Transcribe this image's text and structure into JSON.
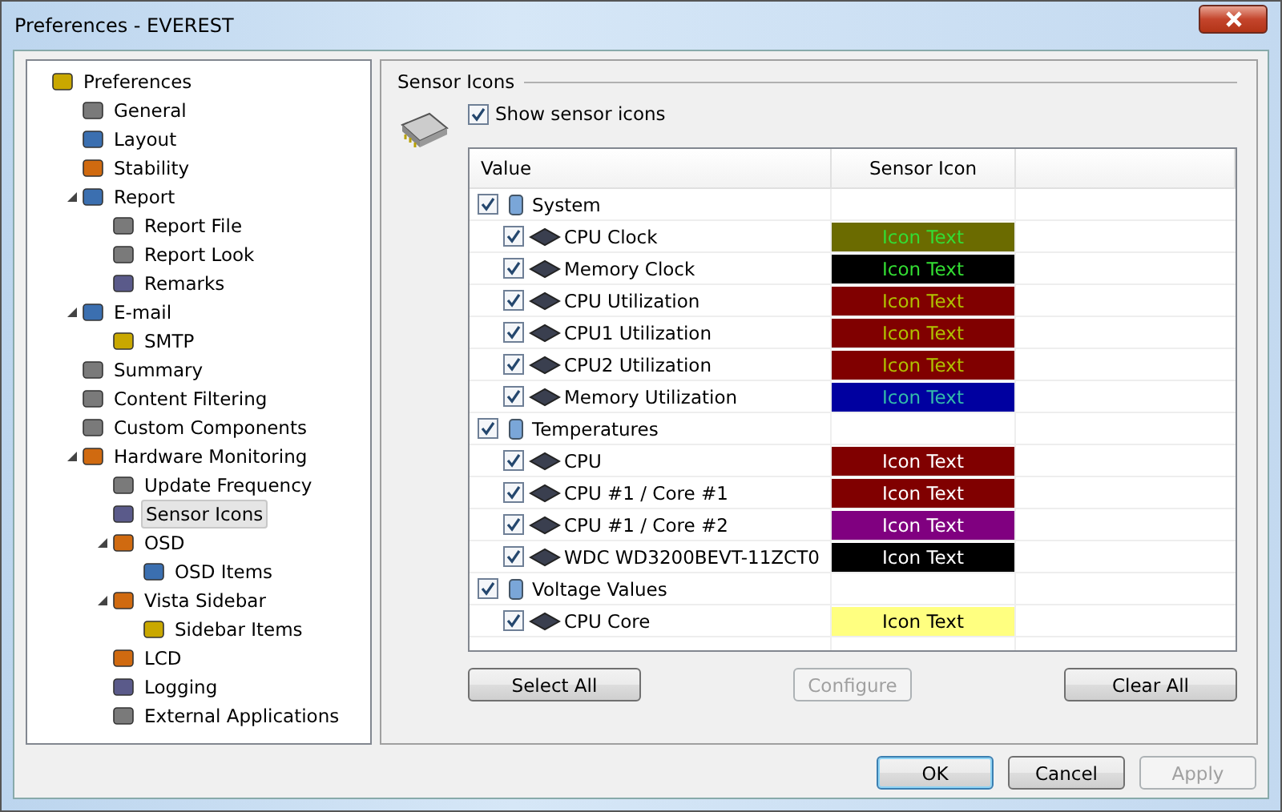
{
  "window": {
    "title": "Preferences - EVEREST"
  },
  "tree": [
    {
      "label": "Preferences",
      "selected": false,
      "children": [
        {
          "label": "General",
          "selected": false
        },
        {
          "label": "Layout",
          "selected": false
        },
        {
          "label": "Stability",
          "selected": false
        },
        {
          "label": "Report",
          "selected": false,
          "expanded": true,
          "children": [
            {
              "label": "Report File",
              "selected": false
            },
            {
              "label": "Report Look",
              "selected": false
            },
            {
              "label": "Remarks",
              "selected": false
            }
          ]
        },
        {
          "label": "E-mail",
          "selected": false,
          "expanded": true,
          "children": [
            {
              "label": "SMTP",
              "selected": false
            }
          ]
        },
        {
          "label": "Summary",
          "selected": false
        },
        {
          "label": "Content Filtering",
          "selected": false
        },
        {
          "label": "Custom Components",
          "selected": false
        },
        {
          "label": "Hardware Monitoring",
          "selected": false,
          "expanded": true,
          "children": [
            {
              "label": "Update Frequency",
              "selected": false
            },
            {
              "label": "Sensor Icons",
              "selected": true
            },
            {
              "label": "OSD",
              "selected": false,
              "expanded": true,
              "children": [
                {
                  "label": "OSD Items",
                  "selected": false
                }
              ]
            },
            {
              "label": "Vista Sidebar",
              "selected": false,
              "expanded": true,
              "children": [
                {
                  "label": "Sidebar Items",
                  "selected": false
                }
              ]
            },
            {
              "label": "LCD",
              "selected": false
            },
            {
              "label": "Logging",
              "selected": false
            },
            {
              "label": "External Applications",
              "selected": false
            }
          ]
        }
      ]
    }
  ],
  "section": {
    "title": "Sensor Icons",
    "show_checkbox": {
      "label": "Show sensor icons",
      "checked": true
    }
  },
  "table": {
    "columns": [
      "Value",
      "Sensor Icon"
    ],
    "rows": [
      {
        "kind": "group",
        "label": "System",
        "checked": true
      },
      {
        "kind": "sensor",
        "label": "CPU Clock",
        "checked": true,
        "sample": {
          "text": "Icon Text",
          "color": "#33dd33"
        },
        "color": "#6b6b00"
      },
      {
        "kind": "sensor",
        "label": "Memory Clock",
        "checked": true,
        "sample": {
          "text": "Icon Text",
          "color": "#33dd33"
        },
        "color": "#000000"
      },
      {
        "kind": "sensor",
        "label": "CPU Utilization",
        "checked": true,
        "sample": {
          "text": "Icon Text",
          "color": "#b0c000"
        },
        "color": "#800000"
      },
      {
        "kind": "sensor",
        "label": "CPU1 Utilization",
        "checked": true,
        "sample": {
          "text": "Icon Text",
          "color": "#b0c000"
        },
        "color": "#800000"
      },
      {
        "kind": "sensor",
        "label": "CPU2 Utilization",
        "checked": true,
        "sample": {
          "text": "Icon Text",
          "color": "#b0c000"
        },
        "color": "#800000"
      },
      {
        "kind": "sensor",
        "label": "Memory Utilization",
        "checked": true,
        "sample": {
          "text": "Icon Text",
          "color": "#33bbaa"
        },
        "color": "#0000a0"
      },
      {
        "kind": "group",
        "label": "Temperatures",
        "checked": true
      },
      {
        "kind": "sensor",
        "label": "CPU",
        "checked": true,
        "sample": {
          "text": "Icon Text",
          "color": "#ffffff"
        },
        "color": "#800000"
      },
      {
        "kind": "sensor",
        "label": "CPU #1 / Core #1",
        "checked": true,
        "sample": {
          "text": "Icon Text",
          "color": "#ffffff"
        },
        "color": "#800000"
      },
      {
        "kind": "sensor",
        "label": "CPU #1 / Core #2",
        "checked": true,
        "sample": {
          "text": "Icon Text",
          "color": "#ffffff"
        },
        "color": "#800080"
      },
      {
        "kind": "sensor",
        "label": "WDC WD3200BEVT-11ZCT0",
        "checked": true,
        "sample": {
          "text": "Icon Text",
          "color": "#ffffff"
        },
        "color": "#000000"
      },
      {
        "kind": "group",
        "label": "Voltage Values",
        "checked": true
      },
      {
        "kind": "sensor",
        "label": "CPU Core",
        "checked": true,
        "sample": {
          "text": "Icon Text",
          "color": "#000000"
        },
        "color": "#ffff80"
      }
    ]
  },
  "table_buttons": [
    {
      "label": "Select All",
      "disabled": false
    },
    {
      "label": "Configure",
      "disabled": true
    },
    {
      "label": "Clear All",
      "disabled": false
    }
  ],
  "dialog_buttons": [
    {
      "label": "OK",
      "disabled": false,
      "default": true
    },
    {
      "label": "Cancel",
      "disabled": false,
      "default": false
    },
    {
      "label": "Apply",
      "disabled": true,
      "default": false
    }
  ]
}
